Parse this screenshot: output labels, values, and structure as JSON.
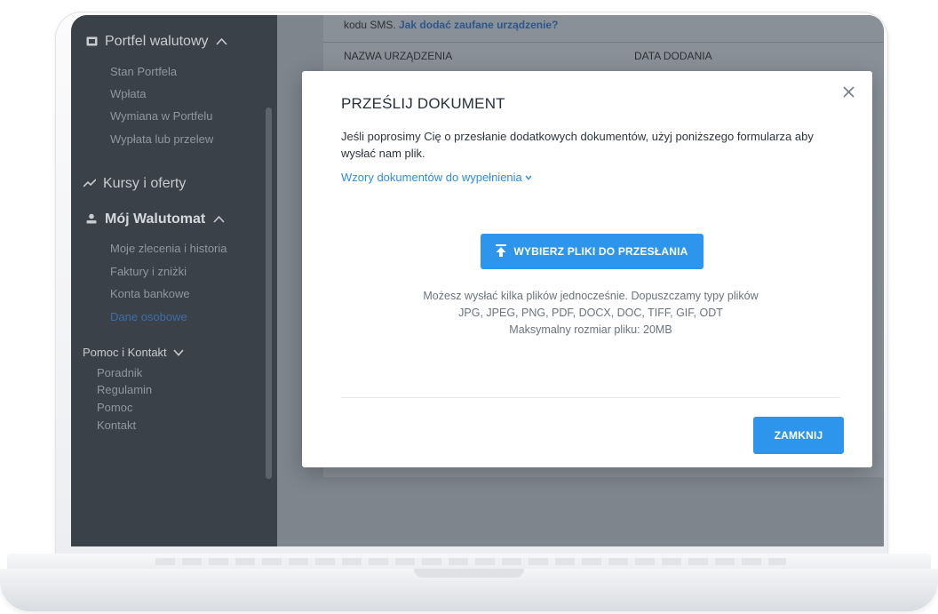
{
  "sidebar": {
    "wallet": {
      "label": "Portfel walutowy",
      "icon": "wallet-icon",
      "chevron": "chevron-up-icon"
    },
    "wallet_items": [
      "Stan Portfela",
      "Wpłata",
      "Wymiana w Portfelu",
      "Wypłata lub przelew"
    ],
    "rates": {
      "label": "Kursy i oferty",
      "icon": "trend-icon"
    },
    "account": {
      "label": "Mój Walutomat",
      "icon": "user-icon",
      "chevron": "chevron-up-icon"
    },
    "account_items": [
      "Moje zlecenia i historia",
      "Faktury i zniżki",
      "Konta bankowe",
      "Dane osobowe"
    ],
    "account_active_index": 3,
    "help": {
      "label": "Pomoc i Kontakt",
      "chevron": "chevron-down-icon"
    },
    "help_items": [
      "Poradnik",
      "Regulamin",
      "Pomoc",
      "Kontakt"
    ]
  },
  "background": {
    "sms_prefix": "kodu SMS.",
    "sms_link": "Jak dodać zaufane urządzenie?",
    "col_device": "NAZWA URZĄDZENIA",
    "col_date": "DATA DODANIA"
  },
  "modal": {
    "title": "PRZEŚLIJ DOKUMENT",
    "description": "Jeśli poprosimy Cię o przesłanie dodatkowych dokumentów, użyj poniższego formularza aby wysłać nam plik.",
    "templates_link": "Wzory dokumentów do wypełnienia",
    "upload_button": "WYBIERZ PLIKI DO PRZESŁANIA",
    "info_line1": "Możesz wysłać kilka plików jednocześnie. Dopuszczamy typy plików",
    "info_line2": "JPG, JPEG, PNG, PDF, DOCX, DOC, TIFF, GIF, ODT",
    "info_line3": "Maksymalny rozmiar pliku: 20MB",
    "close_button": "ZAMKNIJ"
  },
  "colors": {
    "accent": "#2d96ec",
    "sidebar": "#3a4148",
    "overlay": "#7e858d"
  }
}
